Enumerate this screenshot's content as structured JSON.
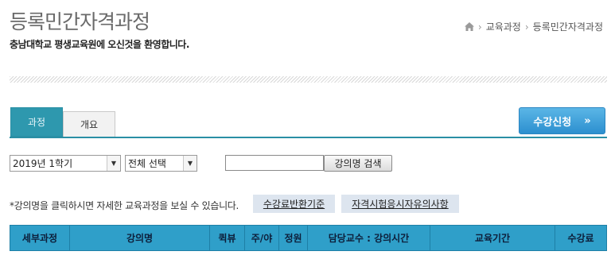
{
  "header": {
    "title": "등록민간자격과정",
    "welcome": "충남대학교 평생교육원에 오신것을 환영합니다."
  },
  "breadcrumb": {
    "icon": "home-icon",
    "items": [
      "교육과정",
      "등록민간자격과정"
    ]
  },
  "tabs": [
    {
      "label": "과정",
      "active": true
    },
    {
      "label": "개요",
      "active": false
    }
  ],
  "apply_button": {
    "label": "수강신청",
    "arrow": "»"
  },
  "filters": {
    "term_select": "2019년 1학기",
    "category_select": "전체 선택",
    "search_value": "",
    "search_button": "강의명 검색"
  },
  "notice": {
    "text": "*강의명을 클릭하시면 자세한 교육과정을 보실 수 있습니다.",
    "refund_link": "수강료반환기준",
    "exam_link": "자격시험응시자유의사항"
  },
  "table": {
    "headers": [
      "세부과정",
      "강의명",
      "퀵뷰",
      "주/야",
      "정원",
      "담당교수 : 강의시간",
      "교육기간",
      "수강료"
    ]
  },
  "colors": {
    "accent": "#2f9fc9",
    "tab_active": "#2e98ae",
    "apply_button": "#2c8fcf"
  }
}
